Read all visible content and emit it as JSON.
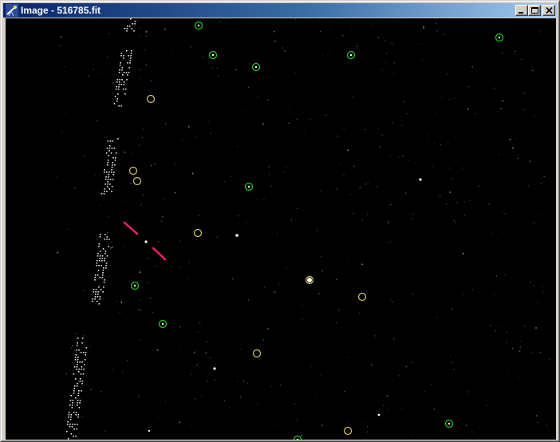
{
  "window": {
    "title": "Image - 516785.fit",
    "icon": "telescope-icon",
    "buttons": {
      "minimize": "minimize-icon",
      "maximize": "maximize-icon",
      "close": "close-icon"
    }
  },
  "colors": {
    "titlebar_start": "#0a246a",
    "titlebar_end": "#a6caf0",
    "green_marker": "#22cc22",
    "yellow_marker": "#d8c860",
    "target_marker": "#e0206a",
    "background": "#000000"
  }
}
